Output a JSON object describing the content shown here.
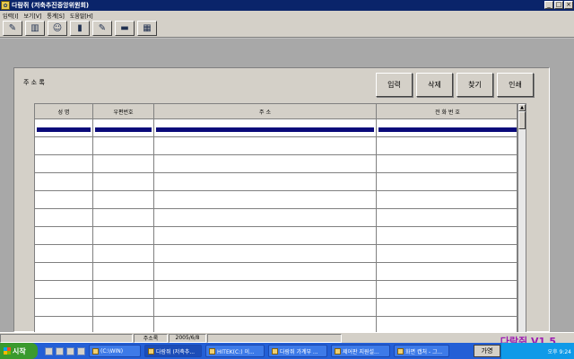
{
  "window": {
    "title": "다람쥐 (저축추진중앙위원회)",
    "controls": [
      "_",
      "□",
      "×"
    ]
  },
  "menu": [
    "입력[I]",
    "보기[V]",
    "통계[S]",
    "도움말[H]"
  ],
  "toolbar": {
    "icons": [
      "edit-icon",
      "book-icon",
      "users-icon",
      "chart-icon",
      "calculator-icon",
      "card-icon",
      "keyboard-icon"
    ],
    "glyphs": [
      "✎",
      "▥",
      "☺",
      "▮",
      "✎",
      "▬",
      "▦"
    ]
  },
  "panel": {
    "label": "주 소 록",
    "buttons": {
      "add": "입력",
      "delete": "삭제",
      "find": "찾기",
      "print": "인쇄"
    }
  },
  "grid": {
    "columns": [
      "성 명",
      "우편번호",
      "주 소",
      "전 화 번 호"
    ],
    "row_count": 12,
    "selected_row": 0
  },
  "status": {
    "section": "주소록",
    "date": "2005/6/8"
  },
  "brand": "다람쥐 V1.5",
  "taskbar": {
    "start": "시작",
    "tasks": [
      "(C:\\WIN)",
      "다람쥐 (저축추...",
      "HITEK(C:) 이...",
      "다람쥐 가계부 ...",
      "제어판 지원설...",
      "화면 캡처 - 그..."
    ],
    "ime": "가영",
    "clock": "오후 9:24"
  }
}
